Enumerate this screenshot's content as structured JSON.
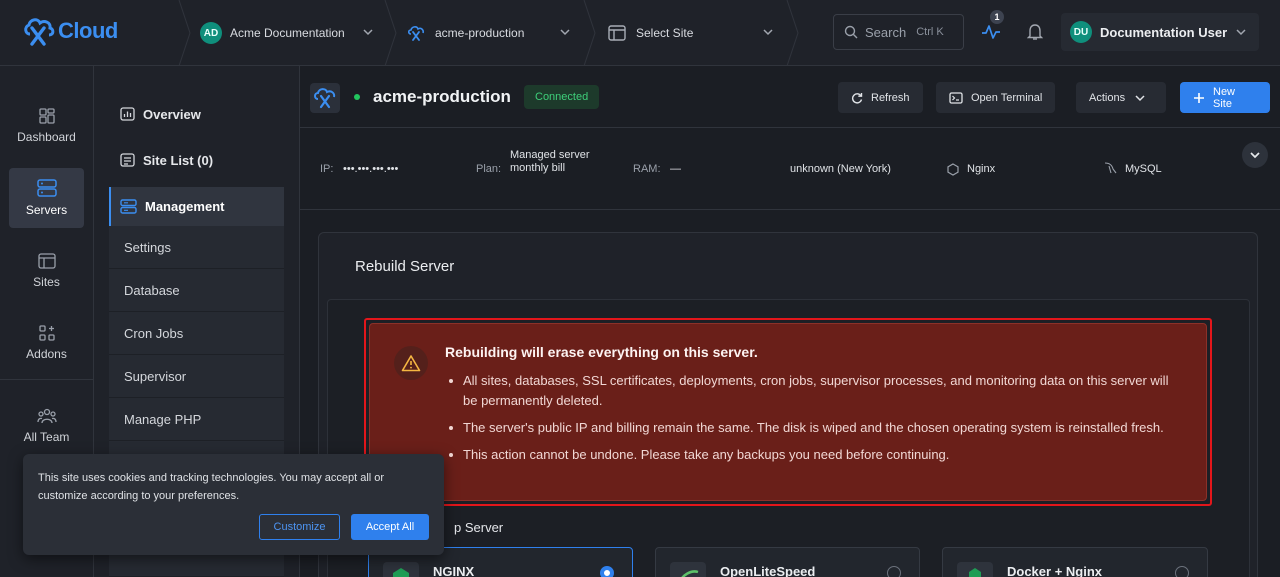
{
  "app": {
    "logo_text": "Cloud"
  },
  "breadcrumbs": {
    "org": {
      "initials": "AD",
      "label": "Acme Documentation"
    },
    "server": {
      "label": "acme-production"
    },
    "site": {
      "label": "Select Site"
    }
  },
  "search": {
    "label": "Search",
    "shortcut": "Ctrl K"
  },
  "activity": {
    "badge": "1"
  },
  "user": {
    "initials": "DU",
    "name": "Documentation User"
  },
  "nav": {
    "items": [
      {
        "label": "Dashboard",
        "icon": "dashboard-icon"
      },
      {
        "label": "Servers",
        "icon": "servers-icon"
      },
      {
        "label": "Sites",
        "icon": "sites-icon"
      },
      {
        "label": "Addons",
        "icon": "addons-icon"
      },
      {
        "label": "All Team",
        "icon": "team-icon"
      }
    ]
  },
  "subnav": {
    "overview": "Overview",
    "site_list": "Site List (0)",
    "management": "Management",
    "items": [
      "Settings",
      "Database",
      "Cron Jobs",
      "Supervisor",
      "Manage PHP"
    ]
  },
  "server": {
    "name": "acme-production",
    "status": "Connected",
    "status_color": "#22c55e"
  },
  "header_actions": {
    "refresh": "Refresh",
    "terminal": "Open Terminal",
    "actions": "Actions",
    "new_site": "New Site"
  },
  "info": {
    "ip_label": "IP:",
    "ip_value": "•••.•••.•••.•••",
    "plan_label": "Plan:",
    "plan_value": "Managed server monthly bill",
    "ram_label": "RAM:",
    "ram_value": "—",
    "location": "unknown (New York)",
    "web_server": "Nginx",
    "database": "MySQL"
  },
  "rebuild": {
    "title": "Rebuild Server",
    "warning_title": "Rebuilding will erase everything on this server.",
    "warning_items": [
      "All sites, databases, SSL certificates, deployments, cron jobs, supervisor processes, and monitoring data on this server will be permanently deleted.",
      "The server's public IP and billing remain the same. The disk is wiped and the chosen operating system is reinstalled fresh.",
      "This action cannot be undone. Please take any backups you need before continuing."
    ],
    "stack_label": "p Server",
    "options": [
      {
        "name": "NGINX",
        "selected": true
      },
      {
        "name": "OpenLiteSpeed",
        "selected": false
      },
      {
        "name": "Docker + Nginx",
        "selected": false
      }
    ]
  },
  "cookie": {
    "text": "This site uses cookies and tracking technologies. You may accept all or customize according to your preferences.",
    "customize": "Customize",
    "accept": "Accept All"
  },
  "colors": {
    "accent": "#2f80ed",
    "warning_bg": "#6a1f19",
    "highlight": "#e3161b"
  }
}
